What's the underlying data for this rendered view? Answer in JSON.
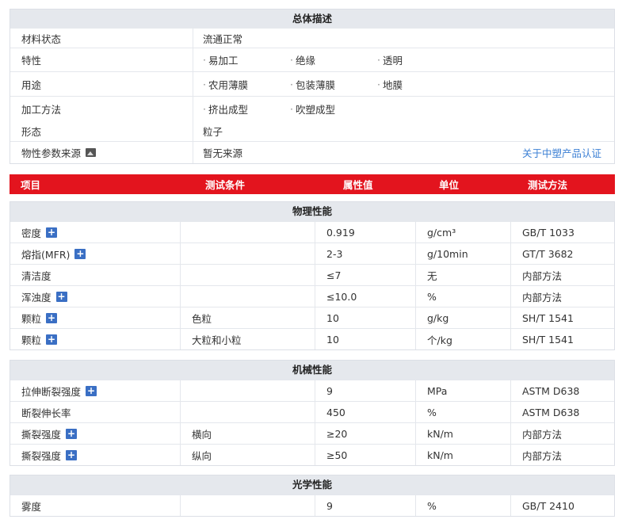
{
  "general": {
    "title": "总体描述",
    "rows": [
      {
        "label": "材料状态",
        "tags": [],
        "text": "流通正常"
      },
      {
        "label": "特性",
        "tags": [
          "易加工",
          "绝缘",
          "透明"
        ],
        "text": ""
      },
      {
        "label": "用途",
        "tags": [
          "农用薄膜",
          "包装薄膜",
          "地膜"
        ],
        "text": ""
      },
      {
        "label": "加工方法",
        "tags": [
          "挤出成型",
          "吹塑成型"
        ],
        "text": ""
      },
      {
        "label": "形态",
        "tags": [],
        "text": "粒子"
      }
    ],
    "source": {
      "label": "物性参数来源",
      "icon": "image-icon",
      "value": "暂无来源",
      "link": "关于中塑产品认证"
    }
  },
  "table_header": [
    "项目",
    "测试条件",
    "属性值",
    "单位",
    "测试方法"
  ],
  "sections": [
    {
      "title": "物理性能",
      "rows": [
        {
          "item": "密度",
          "plus": true,
          "cond": "",
          "value": "0.919",
          "unit": "g/cm³",
          "method": "GB/T 1033"
        },
        {
          "item": "熔指(MFR)",
          "plus": true,
          "cond": "",
          "value": "2-3",
          "unit": "g/10min",
          "method": "GT/T 3682"
        },
        {
          "item": "清洁度",
          "plus": false,
          "cond": "",
          "value": "≤7",
          "unit": "无",
          "method": "内部方法"
        },
        {
          "item": "浑浊度",
          "plus": true,
          "cond": "",
          "value": "≤10.0",
          "unit": "%",
          "method": "内部方法"
        },
        {
          "item": "颗粒",
          "plus": true,
          "cond": "色粒",
          "value": "10",
          "unit": "g/kg",
          "method": "SH/T 1541"
        },
        {
          "item": "颗粒",
          "plus": true,
          "cond": "大粒和小粒",
          "value": "10",
          "unit": "个/kg",
          "method": "SH/T 1541"
        }
      ]
    },
    {
      "title": "机械性能",
      "rows": [
        {
          "item": "拉伸断裂强度",
          "plus": true,
          "cond": "",
          "value": "9",
          "unit": "MPa",
          "method": "ASTM D638"
        },
        {
          "item": "断裂伸长率",
          "plus": false,
          "cond": "",
          "value": "450",
          "unit": "%",
          "method": "ASTM D638"
        },
        {
          "item": "撕裂强度",
          "plus": true,
          "cond": "横向",
          "value": "≥20",
          "unit": "kN/m",
          "method": "内部方法"
        },
        {
          "item": "撕裂强度",
          "plus": true,
          "cond": "纵向",
          "value": "≥50",
          "unit": "kN/m",
          "method": "内部方法"
        }
      ]
    },
    {
      "title": "光学性能",
      "rows": [
        {
          "item": "雾度",
          "plus": false,
          "cond": "",
          "value": "9",
          "unit": "%",
          "method": "GB/T 2410"
        }
      ]
    }
  ],
  "colors": {
    "header_bg": "#e3141e",
    "section_bg": "#e5e8ed",
    "link": "#3b7fd4",
    "plus_icon": "#3a6fc4"
  }
}
